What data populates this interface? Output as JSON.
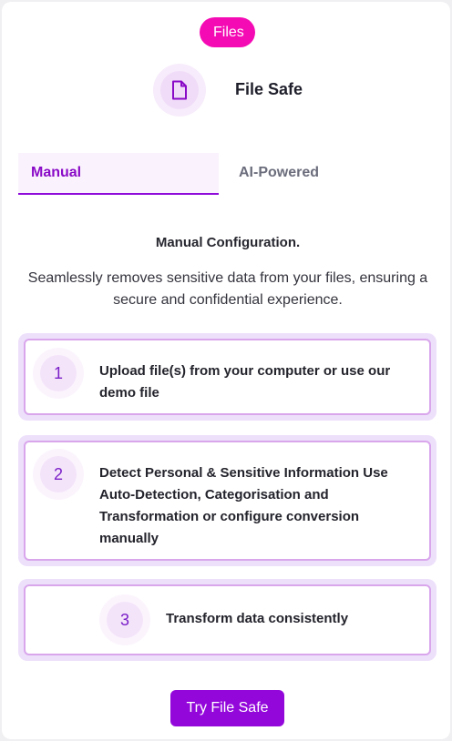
{
  "header": {
    "badge_label": "Files",
    "product_title": "File Safe",
    "product_icon": "document-icon"
  },
  "tabs": [
    {
      "label": "Manual",
      "active": true
    },
    {
      "label": "AI-Powered",
      "active": false
    }
  ],
  "section": {
    "title": "Manual Configuration.",
    "description": "Seamlessly removes sensitive data from your files, ensuring a secure and confidential experience."
  },
  "steps": [
    {
      "number": "1",
      "text": "Upload file(s) from your computer or use our demo file"
    },
    {
      "number": "2",
      "text": "Detect Personal & Sensitive Information Use Auto-Detection, Categorisation and Transformation or configure conversion manually"
    },
    {
      "number": "3",
      "text": "Transform data consistently"
    }
  ],
  "cta": {
    "label": "Try File Safe"
  },
  "colors": {
    "badge": "#f40bb4",
    "accent": "#9307db",
    "step_border": "#d9a6ec",
    "step_background": "#ede0fb"
  }
}
